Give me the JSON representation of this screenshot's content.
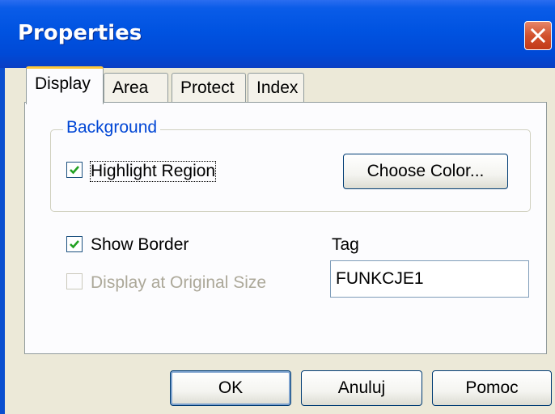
{
  "window": {
    "title": "Properties"
  },
  "tabs": [
    {
      "label": "Display",
      "active": true
    },
    {
      "label": "Area",
      "active": false
    },
    {
      "label": "Protect",
      "active": false
    },
    {
      "label": "Index",
      "active": false
    }
  ],
  "background_group": {
    "title": "Background",
    "highlight_region": {
      "label": "Highlight Region",
      "checked": true
    },
    "choose_color_label": "Choose Color..."
  },
  "show_border": {
    "label": "Show Border",
    "checked": true
  },
  "original_size": {
    "label": "Display at Original Size",
    "checked": false,
    "enabled": false
  },
  "tag": {
    "label": "Tag",
    "value": "FUNKCJE1"
  },
  "buttons": {
    "ok": "OK",
    "cancel": "Anuluj",
    "help": "Pomoc"
  },
  "colors": {
    "titlebar": "#0053e1",
    "dialog_bg": "#ece9d8",
    "panel_bg": "#fcfcfe",
    "group_title": "#0046d5",
    "active_tab_accent": "#ffc83c"
  }
}
